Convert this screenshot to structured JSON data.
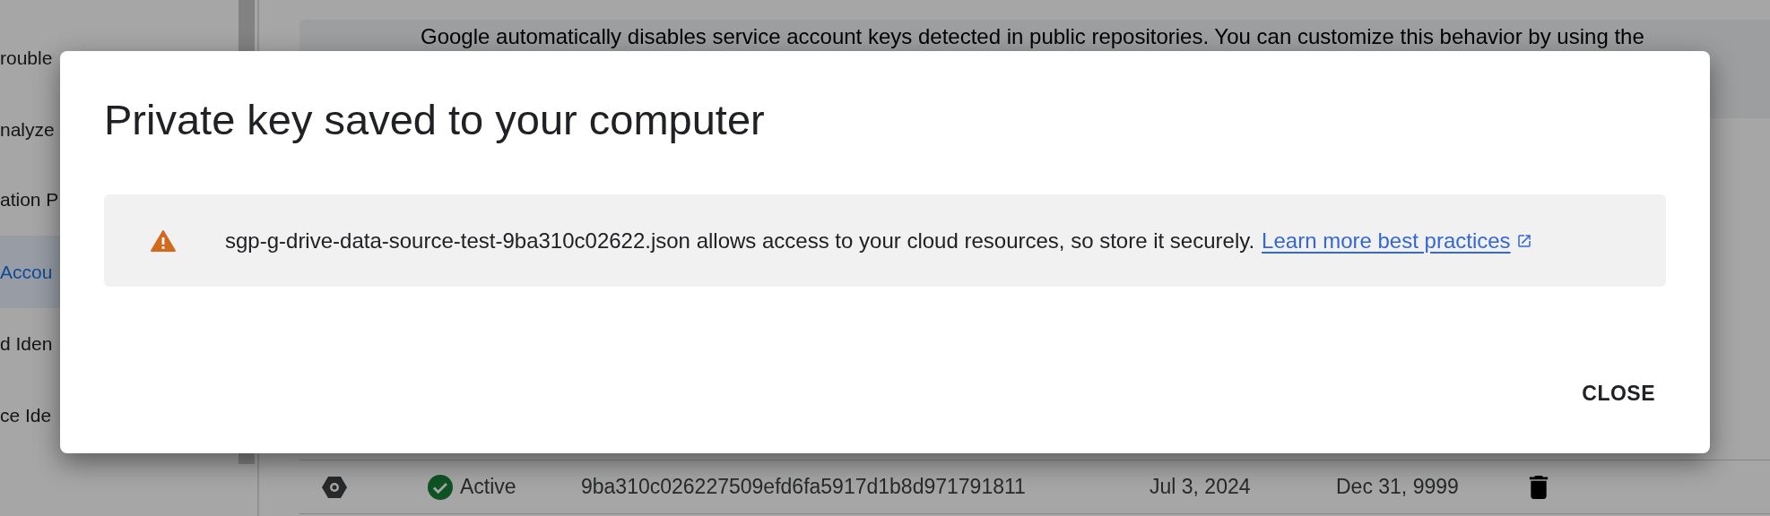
{
  "sidebar": {
    "items": [
      {
        "label": "rouble",
        "selected": false
      },
      {
        "label": "nalyze",
        "selected": false
      },
      {
        "label": "ation P",
        "selected": false
      },
      {
        "label": "Accou",
        "selected": true
      },
      {
        "label": "d Iden",
        "selected": false
      },
      {
        "label": "ce Ide",
        "selected": false
      }
    ]
  },
  "banner": {
    "text": "Google automatically disables service account keys detected in public repositories. You can customize this behavior by using the"
  },
  "keys_table": {
    "rows": [
      {
        "status": "Active",
        "key_id": "9ba310c026227509efd6fa5917d1b8d971791811",
        "created": "Jul 3, 2024",
        "expires": "Dec 31, 9999"
      }
    ]
  },
  "dialog": {
    "title": "Private key saved to your computer",
    "notice": {
      "text": "sgp-g-drive-data-source-test-9ba310c02622.json allows access to your cloud resources, so store it securely.",
      "link": "Learn more best practices"
    },
    "buttons": [
      "CLOSE"
    ]
  }
}
